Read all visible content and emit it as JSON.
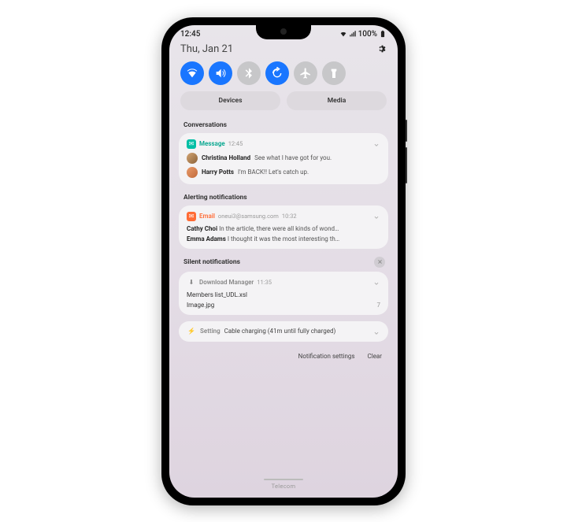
{
  "status": {
    "time": "12:45",
    "battery": "100%"
  },
  "date": "Thu, Jan 21",
  "pills": {
    "devices": "Devices",
    "media": "Media"
  },
  "conversations": {
    "label": "Conversations",
    "app": "Message",
    "time": "12:45",
    "items": [
      {
        "name": "Christina Holland",
        "text": "See what I have got for you."
      },
      {
        "name": "Harry Potts",
        "text": "I'm BACK!! Let's catch up."
      }
    ]
  },
  "alerting": {
    "label": "Alerting notifications",
    "app": "Email",
    "from": "oneui3@samsung.com",
    "time": "10:32",
    "items": [
      {
        "name": "Cathy Choi",
        "text": "In the article, there were all kinds of wond…"
      },
      {
        "name": "Emma Adams",
        "text": "I thought it was the most interesting th…"
      }
    ]
  },
  "silent": {
    "label": "Silent notifications",
    "download": {
      "app": "Download Manager",
      "time": "11:35",
      "file1": "Members list_UDL.xsl",
      "file2": "Image.jpg",
      "count": "7"
    },
    "setting": {
      "app": "Setting",
      "text": "Cable charging (41m until fully charged)"
    }
  },
  "footer": {
    "settings": "Notification settings",
    "clear": "Clear"
  },
  "carrier": "Telecom"
}
